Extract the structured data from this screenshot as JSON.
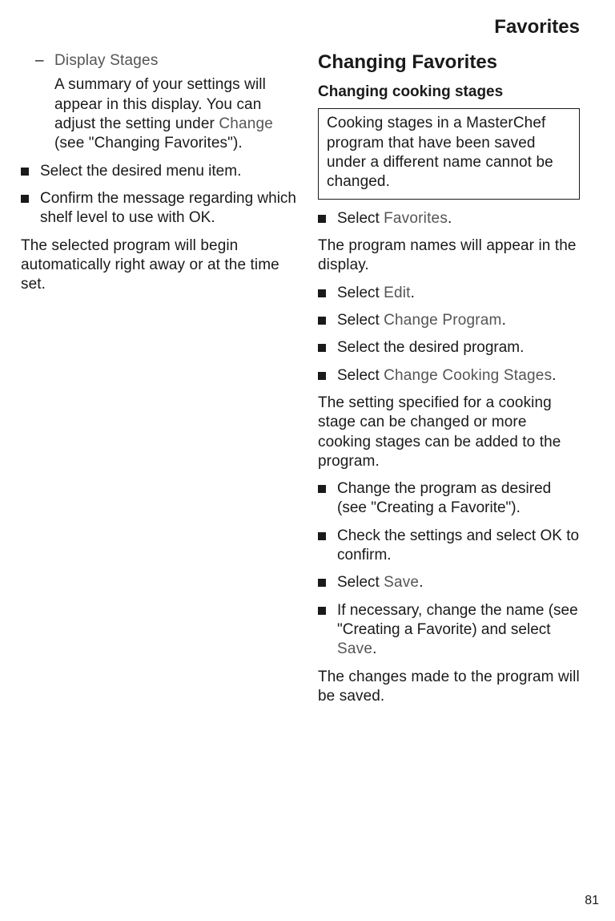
{
  "header": {
    "section_title": "Favorites"
  },
  "left_column": {
    "display_stages_label": "Display Stages",
    "display_stages_desc_prefix": "A summary of your settings will appear in this display. You can adjust the setting under ",
    "display_stages_desc_ui": "Change",
    "display_stages_desc_suffix": " (see \"Changing Favorites\").",
    "step_select_menu": "Select the desired menu item.",
    "step_confirm_shelf": "Confirm the message regarding which shelf level to use with OK.",
    "outcome": "The selected program will begin automatically right away or at the time set."
  },
  "right_column": {
    "h2": "Changing Favorites",
    "h3": "Changing cooking stages",
    "note": "Cooking stages in a MasterChef program that have been saved under a different name cannot be changed.",
    "step_select_favorites_prefix": "Select ",
    "step_select_favorites_ui": "Favorites",
    "step_select_favorites_suffix": ".",
    "after_favorites": "The program names will appear in the display.",
    "step_select_edit_prefix": "Select ",
    "step_select_edit_ui": "Edit",
    "step_select_edit_suffix": ".",
    "step_select_change_program_prefix": "Select ",
    "step_select_change_program_ui": "Change Program",
    "step_select_change_program_suffix": ".",
    "step_select_program": "Select the desired program.",
    "step_select_change_cooking_prefix": "Select ",
    "step_select_change_cooking_ui": "Change Cooking Stages",
    "step_select_change_cooking_suffix": ".",
    "explain_change": "The setting specified for a cooking stage can be changed or more cooking stages can be added to the program.",
    "step_change_program": "Change the program as desired (see \"Creating a Favorite\").",
    "step_check_settings": "Check the settings and select OK to confirm.",
    "step_select_save_prefix": "Select ",
    "step_select_save_ui": "Save",
    "step_select_save_suffix": ".",
    "step_change_name_prefix": "If necessary, change the name (see \"Creating a Favorite) and select ",
    "step_change_name_ui": "Save",
    "step_change_name_suffix": ".",
    "result": "The changes made to the program will be saved."
  },
  "footer": {
    "page_number": "81"
  }
}
